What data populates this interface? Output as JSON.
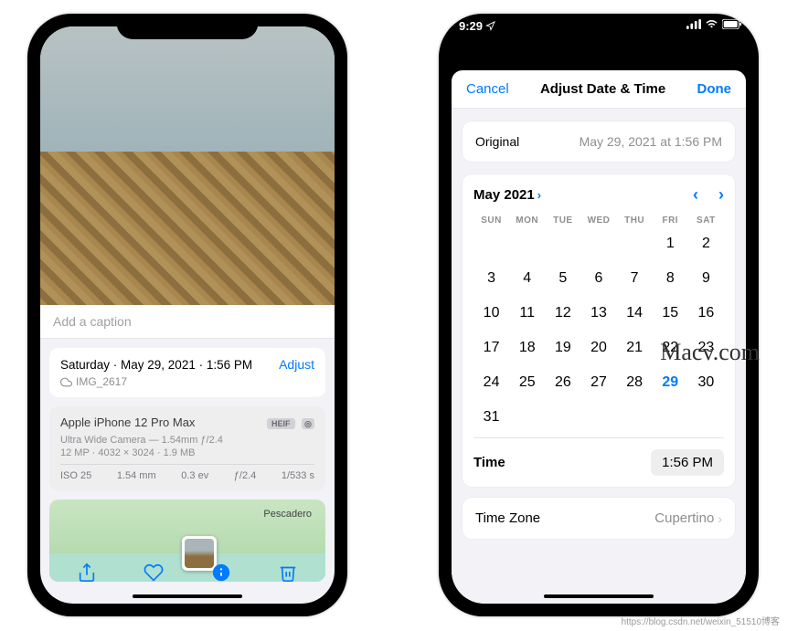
{
  "left": {
    "caption_placeholder": "Add a caption",
    "date_line": "Saturday · May 29, 2021 · 1:56 PM",
    "adjust_label": "Adjust",
    "filename": "IMG_2617",
    "device": "Apple iPhone 12 Pro Max",
    "format_badge": "HEIF",
    "lens_line": "Ultra Wide Camera — 1.54mm ƒ/2.4",
    "res_line": "12 MP · 4032 × 3024 · 1.9 MB",
    "specs": {
      "iso": "ISO 25",
      "focal": "1.54 mm",
      "ev": "0.3 ev",
      "aperture": "ƒ/2.4",
      "shutter": "1/533 s"
    },
    "map_label": "Pescadero"
  },
  "right": {
    "status_time": "9:29",
    "cancel": "Cancel",
    "title": "Adjust Date & Time",
    "done": "Done",
    "original_label": "Original",
    "original_value": "May 29, 2021 at 1:56 PM",
    "month": "May 2021",
    "dow": [
      "SUN",
      "MON",
      "TUE",
      "WED",
      "THU",
      "FRI",
      "SAT"
    ],
    "days": [
      "",
      "",
      "",
      "",
      "",
      "1",
      "2",
      "3",
      "4",
      "5",
      "6",
      "7",
      "8",
      "9",
      "10",
      "11",
      "12",
      "13",
      "14",
      "15",
      "16",
      "17",
      "18",
      "19",
      "20",
      "21",
      "22",
      "23",
      "24",
      "25",
      "26",
      "27",
      "28",
      "29",
      "30",
      "31",
      "",
      "",
      "",
      "",
      "",
      ""
    ],
    "selected_day": "29",
    "time_label": "Time",
    "time_value": "1:56 PM",
    "tz_label": "Time Zone",
    "tz_value": "Cupertino"
  },
  "watermark": "Macv.com",
  "footer": "https://blog.csdn.net/weixin_51510博客"
}
